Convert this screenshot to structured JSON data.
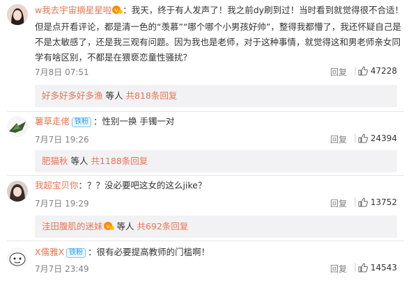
{
  "comments": [
    {
      "user": "w我去宇宙摘星星啦",
      "text": "：我天，终于有人发声了！我之前dy刷到过！当时看到就觉得很不合适！但是点开看评论，都是清一色的“羡慕”“哪个哪个小男孩好帅”，整得我都懵了，我还怀疑自己是不是太敏感了，还是我三观有问题。因为我也是老师，对于这种事情，就觉得这和男老师亲女同学有啥区别，不都是在猥亵恋童性骚扰？",
      "time": "7月8日 07:51",
      "reply_label": "回复",
      "likes": "47228",
      "sub_user": "好多好多好多渔",
      "sub_text_pre": "等人",
      "sub_count_link": "共818条回复"
    },
    {
      "user": "薯草走佬",
      "fan_badge": "铁粉",
      "text": "：性别一换 手镯一对",
      "time": "7月7日 19:26",
      "reply_label": "回复",
      "likes": "24394",
      "sub_user": "肥猫秋",
      "sub_text_pre": "等人",
      "sub_count_link": "共1188条回复"
    },
    {
      "user": "我超宝贝你",
      "text": "：？？没必要吧这女的这么jike？",
      "time": "7月7日 19:29",
      "reply_label": "回复",
      "likes": "13752",
      "sub_user": "洼田腹肌的迷妹",
      "sub_text_pre": "等人",
      "sub_count_link": "共692条回复"
    },
    {
      "user": "X儒雅X",
      "fan_badge": "铁粉",
      "text": "：很有必要提高教师的门槛啊！",
      "time": "7月7日 23:49",
      "reply_label": "回复",
      "likes": "14543"
    }
  ],
  "colors": {
    "username": "#eb7350",
    "meta": "#808080",
    "sub_bg": "#f2f2f5"
  }
}
